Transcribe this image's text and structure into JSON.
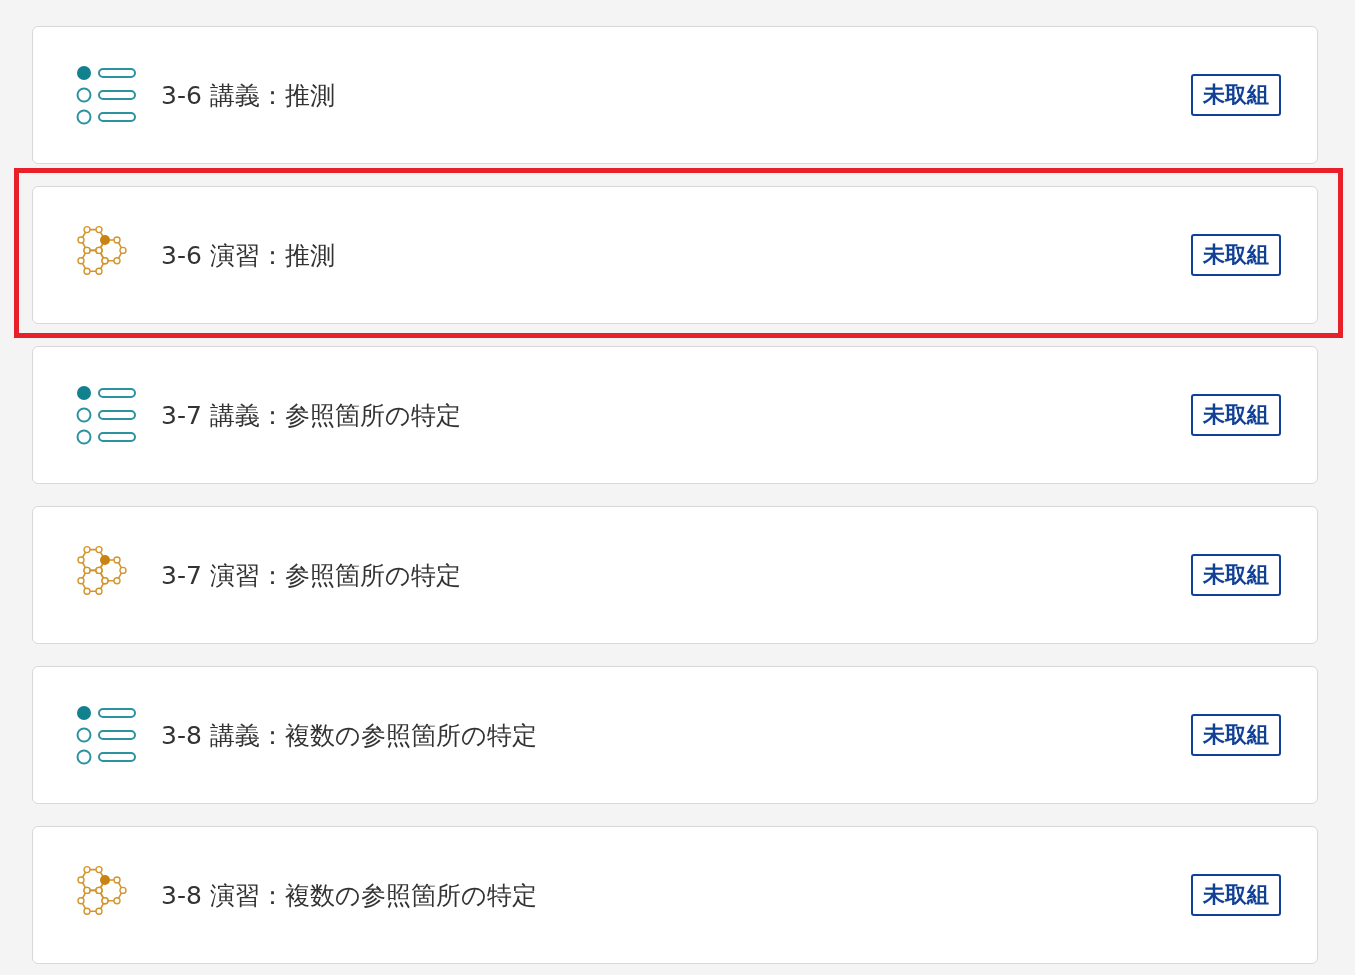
{
  "items": [
    {
      "kind": "lecture",
      "title": "3-6 講義：推測",
      "status": "未取組",
      "highlighted": false
    },
    {
      "kind": "exercise",
      "title": "3-6 演習：推測",
      "status": "未取組",
      "highlighted": true
    },
    {
      "kind": "lecture",
      "title": "3-7 講義：参照箇所の特定",
      "status": "未取組",
      "highlighted": false
    },
    {
      "kind": "exercise",
      "title": "3-7 演習：参照箇所の特定",
      "status": "未取組",
      "highlighted": false
    },
    {
      "kind": "lecture",
      "title": "3-8 講義：複数の参照箇所の特定",
      "status": "未取組",
      "highlighted": false
    },
    {
      "kind": "exercise",
      "title": "3-8 演習：複数の参照箇所の特定",
      "status": "未取組",
      "highlighted": false
    }
  ]
}
